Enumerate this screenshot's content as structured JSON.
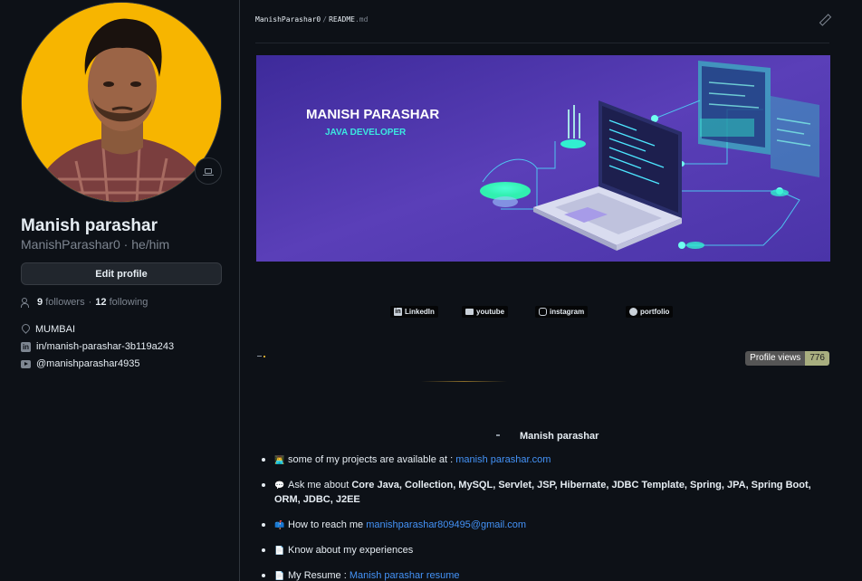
{
  "profile": {
    "name": "Manish parashar",
    "username": "ManishParashar0",
    "pronouns_sep": "·",
    "pronouns": "he/him",
    "edit_label": "Edit profile",
    "followers_count": "9",
    "followers_label": "followers",
    "dot": "·",
    "following_count": "12",
    "following_label": "following",
    "location": "MUMBAI",
    "linkedin": "in/manish-parashar-3b119a243",
    "youtube": "@manishparashar4935"
  },
  "readme": {
    "owner": "ManishParashar0",
    "sep": "/",
    "file": "README",
    "ext": ".md",
    "banner": {
      "name": "MANISH PARASHAR",
      "role": "JAVA DEVELOPER"
    },
    "badges": [
      {
        "label": "LinkedIn",
        "icon": "linkedin-icon"
      },
      {
        "label": "youtube",
        "icon": "youtube-icon"
      },
      {
        "label": "instagram",
        "icon": "instagram-icon"
      },
      {
        "label": "portfolio",
        "icon": "portfolio-icon"
      }
    ],
    "views": {
      "label": "Profile views",
      "count": "776"
    },
    "section_title": "Manish parashar",
    "items": [
      {
        "emoji": "👨‍💻",
        "text": "some of my projects are available at :",
        "link": "manish parashar.com"
      },
      {
        "emoji": "💬",
        "prefix": "Ask me about",
        "text": "Core Java, Collection, MySQL, Servlet, JSP, Hibernate, JDBC Template, Spring, JPA, Spring Boot, ORM, JDBC, J2EE"
      },
      {
        "emoji": "📫",
        "text": "How to reach me",
        "link": "manishparashar809495@gmail.com"
      },
      {
        "emoji": "📄",
        "text": "Know about my experiences"
      },
      {
        "emoji": "📄",
        "text": "My Resume :",
        "link": "Manish parashar resume"
      }
    ]
  },
  "colors": {
    "background": "#0d1117",
    "avatar_bg": "#f7b500",
    "banner_bg": "#5a3fb8",
    "accent_cyan": "#31f0d0",
    "link": "#4493f8",
    "views_count_bg": "#a8ae7f"
  }
}
